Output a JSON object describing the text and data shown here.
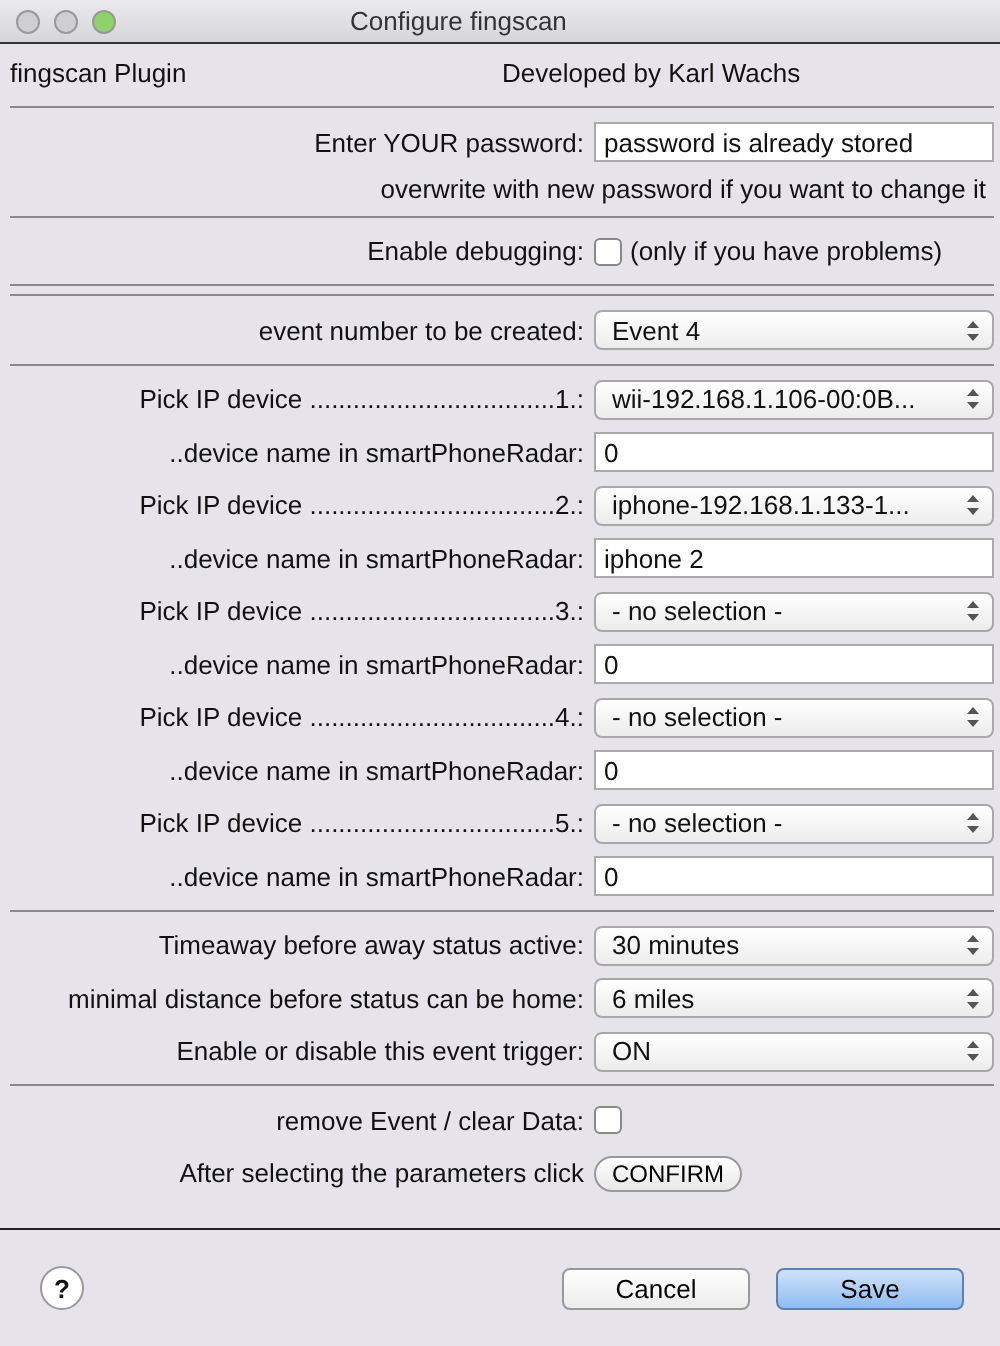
{
  "window": {
    "title": "Configure fingscan",
    "controls": [
      {
        "kind": "close",
        "active": false
      },
      {
        "kind": "minimize",
        "active": false
      },
      {
        "kind": "zoom",
        "active": true
      }
    ]
  },
  "header": {
    "plugin": "fingscan Plugin",
    "author": "Developed by Karl Wachs"
  },
  "rows": [
    {
      "kind": "separator"
    },
    {
      "kind": "field",
      "label": "Enter YOUR password:",
      "value": "password is already stored"
    },
    {
      "kind": "note",
      "text": "overwrite with new password if you want to change it"
    },
    {
      "kind": "separator"
    },
    {
      "kind": "checkbox",
      "label": "Enable debugging:",
      "checked": false,
      "hint": "(only if you have problems)"
    },
    {
      "kind": "separator"
    },
    {
      "kind": "separator"
    },
    {
      "kind": "select",
      "label": "event number to be created:",
      "value": "Event 4"
    },
    {
      "kind": "separator"
    },
    {
      "kind": "select",
      "label": "Pick IP device ..................................1.:",
      "value": "wii-192.168.1.106-00:0B..."
    },
    {
      "kind": "field",
      "label": "..device name in smartPhoneRadar:",
      "value": "0"
    },
    {
      "kind": "select",
      "label": "Pick IP device ..................................2.:",
      "value": "iphone-192.168.1.133-1..."
    },
    {
      "kind": "field",
      "label": "..device name in smartPhoneRadar:",
      "value": "iphone 2"
    },
    {
      "kind": "select",
      "label": "Pick IP device ..................................3.:",
      "value": "- no selection -"
    },
    {
      "kind": "field",
      "label": "..device name in smartPhoneRadar:",
      "value": "0"
    },
    {
      "kind": "select",
      "label": "Pick IP device ..................................4.:",
      "value": "- no selection -"
    },
    {
      "kind": "field",
      "label": "..device name in smartPhoneRadar:",
      "value": "0"
    },
    {
      "kind": "select",
      "label": "Pick IP device ..................................5.:",
      "value": "- no selection -"
    },
    {
      "kind": "field",
      "label": "..device name in smartPhoneRadar:",
      "value": "0"
    },
    {
      "kind": "separator"
    },
    {
      "kind": "select",
      "label": "Timeaway before away status active:",
      "value": "30 minutes"
    },
    {
      "kind": "select",
      "label": "minimal distance before status can be home:",
      "value": "6 miles"
    },
    {
      "kind": "select",
      "label": "Enable or disable this event trigger:",
      "value": "ON"
    },
    {
      "kind": "separator"
    },
    {
      "kind": "checkbox",
      "label": "remove Event / clear Data:",
      "checked": false
    },
    {
      "kind": "button",
      "label": "After selecting the parameters click",
      "value": "CONFIRM"
    }
  ],
  "footer": {
    "help": "?",
    "buttons": [
      {
        "label": "Cancel",
        "default": false
      },
      {
        "label": "Save",
        "default": true
      }
    ]
  }
}
